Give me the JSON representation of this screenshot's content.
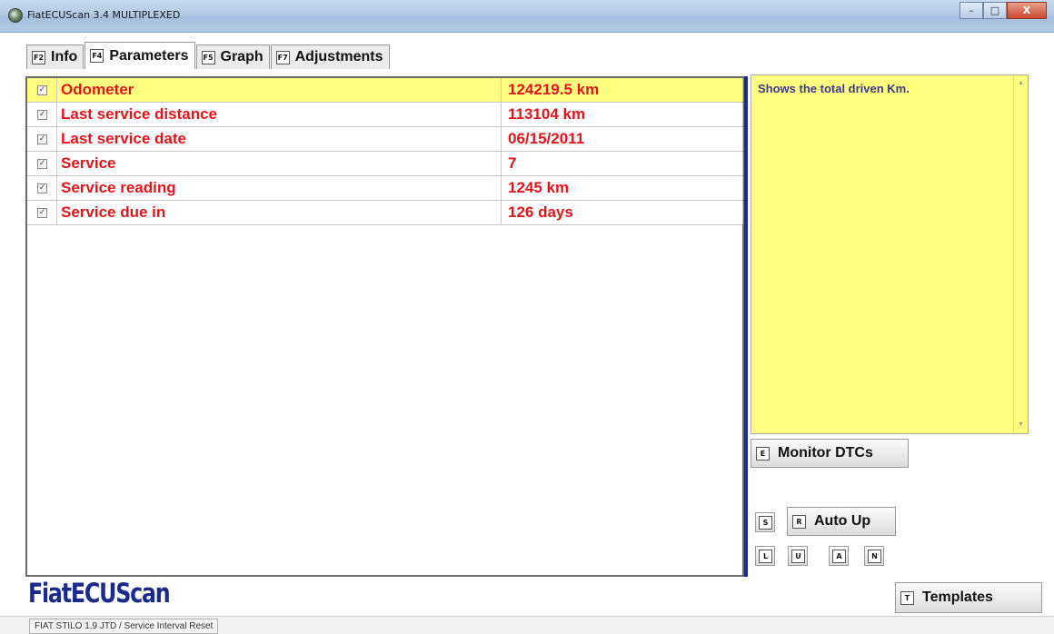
{
  "window": {
    "title": "FiatECUScan 3.4 MULTIPLEXED",
    "minimize": "–",
    "maximize": "□",
    "close": "X"
  },
  "tabs": [
    {
      "key": "F2",
      "label": "Info"
    },
    {
      "key": "F4",
      "label": "Parameters"
    },
    {
      "key": "F5",
      "label": "Graph"
    },
    {
      "key": "F7",
      "label": "Adjustments"
    }
  ],
  "active_tab": "Parameters",
  "parameters": [
    {
      "checked": true,
      "check_glyph": "✓",
      "name": "Odometer",
      "value": "124219.5 km",
      "selected": true
    },
    {
      "checked": true,
      "check_glyph": "✓",
      "name": "Last service distance",
      "value": "113104 km"
    },
    {
      "checked": true,
      "check_glyph": "✓",
      "name": "Last service date",
      "value": "06/15/2011"
    },
    {
      "checked": true,
      "check_glyph": "✓",
      "name": "Service",
      "value": "7"
    },
    {
      "checked": true,
      "check_glyph": "✓",
      "name": "Service reading",
      "value": "1245 km"
    },
    {
      "checked": true,
      "check_glyph": "✓",
      "name": "Service due in",
      "value": "126 days"
    }
  ],
  "description": {
    "text": "Shows the total driven Km.",
    "scroll_up": "▲",
    "scroll_down": "▼"
  },
  "buttons": {
    "monitor_dtcs": {
      "key": "E",
      "label": "Monitor DTCs"
    },
    "s": {
      "key": "S"
    },
    "auto_up": {
      "key": "R",
      "label": "Auto Up"
    },
    "l": {
      "key": "L"
    },
    "u": {
      "key": "U"
    },
    "a": {
      "key": "A"
    },
    "n": {
      "key": "N"
    },
    "templates": {
      "key": "T",
      "label": "Templates"
    }
  },
  "logo": "FiatECUScan",
  "status": "FIAT STILO 1.9 JTD / Service Interval Reset",
  "colors": {
    "param_text": "#e0161c",
    "selected_row": "#ffff80",
    "description_bg": "#ffff80",
    "logo": "#1c2a8a",
    "splitter": "#1c2a8a"
  },
  "icons": {
    "app": "app-icon",
    "checkbox": "checkbox-icon"
  }
}
